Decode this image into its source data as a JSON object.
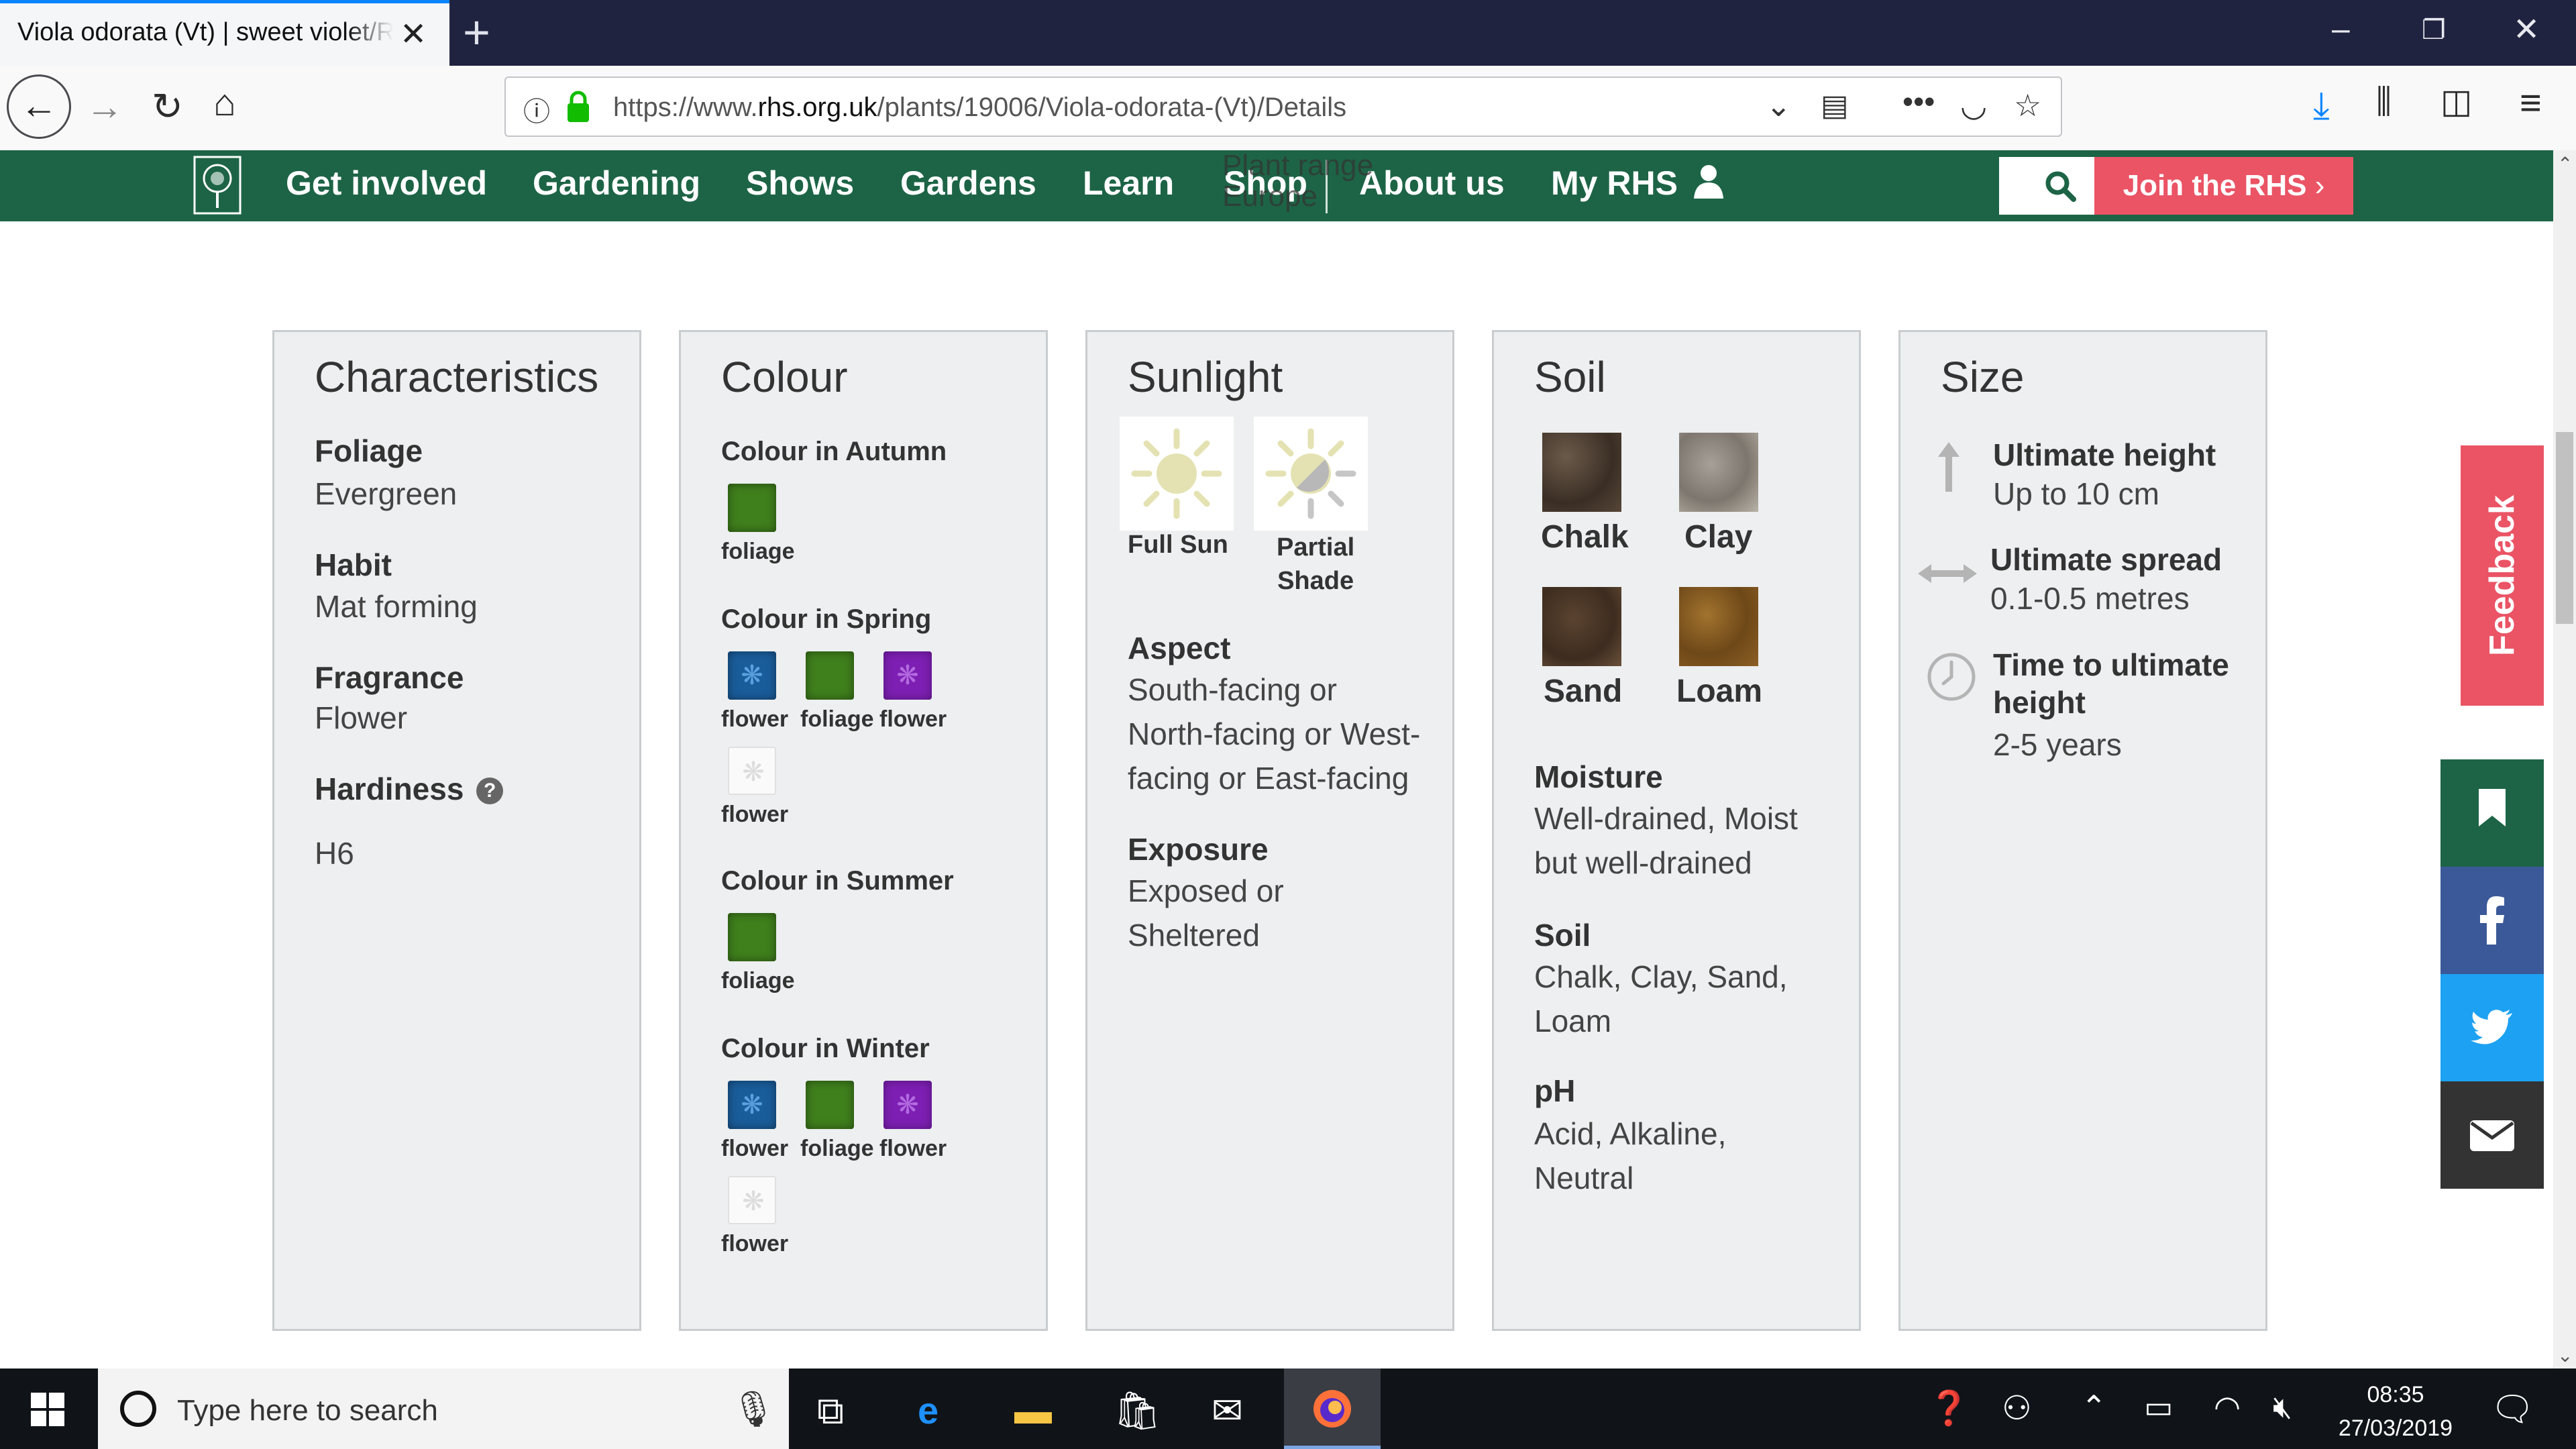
{
  "browser": {
    "tab_title": "Viola odorata (Vt) | sweet violet/RHS Gardening",
    "url_prefix": "https://www.",
    "url_domain": "rhs.org.uk",
    "url_path": "/plants/19006/Viola-odorata-(Vt)/Details"
  },
  "site_nav": {
    "items": [
      "Get involved",
      "Gardening",
      "Shows",
      "Gardens",
      "Learn",
      "Shop",
      "About us",
      "My RHS"
    ],
    "overlay_line1": "Plant range",
    "overlay_line2": "Europe",
    "join_label": "Join the RHS",
    "join_chevron": "›"
  },
  "characteristics": {
    "title": "Characteristics",
    "foliage_label": "Foliage",
    "foliage_value": "Evergreen",
    "habit_label": "Habit",
    "habit_value": "Mat forming",
    "fragrance_label": "Fragrance",
    "fragrance_value": "Flower",
    "hardiness_label": "Hardiness",
    "hardiness_value": "H6",
    "help_glyph": "?"
  },
  "colour": {
    "title": "Colour",
    "autumn_label": "Colour in Autumn",
    "spring_label": "Colour in Spring",
    "summer_label": "Colour in Summer",
    "winter_label": "Colour in Winter",
    "flower": "flower",
    "foliage": "foliage"
  },
  "sunlight": {
    "title": "Sunlight",
    "full_sun": "Full Sun",
    "partial_line1": "Partial",
    "partial_line2": "Shade",
    "aspect_label": "Aspect",
    "aspect_lines": [
      "South-facing or",
      "North-facing or West-",
      "facing or East-facing"
    ],
    "exposure_label": "Exposure",
    "exposure_lines": [
      "Exposed or",
      "Sheltered"
    ]
  },
  "soil": {
    "title": "Soil",
    "types": [
      "Chalk",
      "Clay",
      "Sand",
      "Loam"
    ],
    "moisture_label": "Moisture",
    "moisture_lines": [
      "Well-drained, Moist",
      "but well-drained"
    ],
    "soil_label": "Soil",
    "soil_lines": [
      "Chalk, Clay, Sand,",
      "Loam"
    ],
    "ph_label": "pH",
    "ph_lines": [
      "Acid, Alkaline,",
      "Neutral"
    ]
  },
  "size": {
    "title": "Size",
    "height_label": "Ultimate height",
    "height_value": "Up to 10 cm",
    "spread_label": "Ultimate spread",
    "spread_value": "0.1-0.5 metres",
    "time_label_line1": "Time to ultimate",
    "time_label_line2": "height",
    "time_value": "2-5 years"
  },
  "rail": {
    "feedback": "Feedback"
  },
  "taskbar": {
    "search_placeholder": "Type here to search",
    "time": "08:35",
    "date": "27/03/2019"
  },
  "colors": {
    "rhs_green": "#1d6446",
    "join_red": "#ea5465",
    "bookmark": "#1d6446",
    "facebook": "#3b5998",
    "twitter": "#1da1f2",
    "email": "#333333"
  }
}
